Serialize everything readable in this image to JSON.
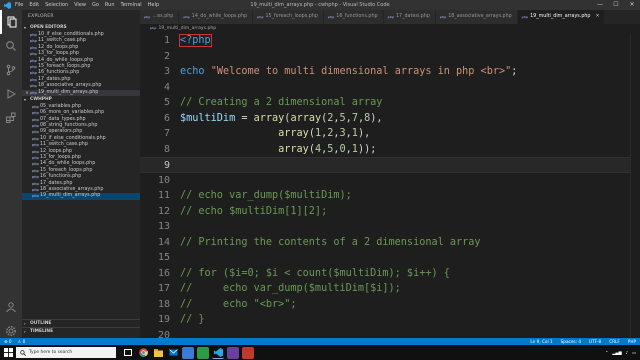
{
  "window": {
    "title": "19_multi_dim_arrays.php - cwhphp - Visual Studio Code",
    "menu": [
      "File",
      "Edit",
      "Selection",
      "View",
      "Go",
      "Run",
      "Terminal",
      "Help"
    ]
  },
  "sidebar": {
    "title": "EXPLORER",
    "open_editors_label": "OPEN EDITORS",
    "open_editors": [
      "10_if_else_conditionals.php",
      "11_switch_case.php",
      "12_do_loops.php",
      "13_for_loops.php",
      "14_do_while_loops.php",
      "15_foreach_loops.php",
      "16_functions.php",
      "17_dates.php",
      "18_associative_arrays.php",
      "19_multi_dim_arrays.php"
    ],
    "project_label": "CWHPHP",
    "files": [
      "05_variables.php",
      "06_more_on_variables.php",
      "07_data_types.php",
      "08_string_functions.php",
      "09_operators.php",
      "10_if_else_conditionals.php",
      "11_switch_case.php",
      "12_loops.php",
      "13_for_loops.php",
      "14_do_while_loops.php",
      "15_foreach_loops.php",
      "16_functions.php",
      "17_dates.php",
      "18_associative_arrays.php",
      "19_multi_dim_arrays.php"
    ],
    "outline_label": "OUTLINE",
    "timeline_label": "TIMELINE"
  },
  "tabs": [
    {
      "label": "…es.php",
      "active": false
    },
    {
      "label": "14_do_while_loops.php",
      "active": false
    },
    {
      "label": "15_foreach_loops.php",
      "active": false
    },
    {
      "label": "16_functions.php",
      "active": false
    },
    {
      "label": "17_datesi.php",
      "active": false
    },
    {
      "label": "18_associative_arrays.php",
      "active": false
    },
    {
      "label": "19_multi_dim_arrays.php",
      "active": true
    }
  ],
  "breadcrumb": "19_multi_dim_arrays.php",
  "editor": {
    "current_line": 9,
    "lines": [
      {
        "n": "1",
        "html": "<span class=\"k-tag phpopen\">&lt;?php</span>"
      },
      {
        "n": "2",
        "html": ""
      },
      {
        "n": "3",
        "html": "<span class=\"k-kw\">echo</span> <span class=\"k-str\">\"Welcome to multi dimensional arrays in php &lt;br&gt;\"</span><span class=\"k-op\">;</span>"
      },
      {
        "n": "4",
        "html": ""
      },
      {
        "n": "5",
        "html": "<span class=\"k-com\">// Creating a 2 dimensional array</span>"
      },
      {
        "n": "6",
        "html": "<span class=\"k-var\">$multiDim</span> <span class=\"k-op\">=</span> <span class=\"k-fn\">array</span><span class=\"k-op\">(</span><span class=\"k-fn\">array</span><span class=\"k-op\">(</span><span class=\"k-num\">2</span><span class=\"k-op\">,</span><span class=\"k-num\">5</span><span class=\"k-op\">,</span><span class=\"k-num\">7</span><span class=\"k-op\">,</span><span class=\"k-num\">8</span><span class=\"k-op\">),</span>"
      },
      {
        "n": "7",
        "html": "                <span class=\"k-fn\">array</span><span class=\"k-op\">(</span><span class=\"k-num\">1</span><span class=\"k-op\">,</span><span class=\"k-num\">2</span><span class=\"k-op\">,</span><span class=\"k-num\">3</span><span class=\"k-op\">,</span><span class=\"k-num\">1</span><span class=\"k-op\">),</span>"
      },
      {
        "n": "8",
        "html": "                <span class=\"k-fn\">array</span><span class=\"k-op\">(</span><span class=\"k-num\">4</span><span class=\"k-op\">,</span><span class=\"k-num\">5</span><span class=\"k-op\">,</span><span class=\"k-num\">0</span><span class=\"k-op\">,</span><span class=\"k-num\">1</span><span class=\"k-op\">));</span>"
      },
      {
        "n": "9",
        "html": ""
      },
      {
        "n": "10",
        "html": ""
      },
      {
        "n": "11",
        "html": "<span class=\"k-com\">// echo var_dump($multiDim);</span>"
      },
      {
        "n": "12",
        "html": "<span class=\"k-com\">// echo $multiDim[1][2];</span>"
      },
      {
        "n": "13",
        "html": ""
      },
      {
        "n": "14",
        "html": "<span class=\"k-com\">// Printing the contents of a 2 dimensional array</span>"
      },
      {
        "n": "15",
        "html": ""
      },
      {
        "n": "16",
        "html": "<span class=\"k-com\">// for ($i=0; $i &lt; count($multiDim); $i++) {</span>"
      },
      {
        "n": "17",
        "html": "<span class=\"k-com\">//     echo var_dump($multiDim[$i]);</span>"
      },
      {
        "n": "18",
        "html": "<span class=\"k-com\">//     echo \"&lt;br&gt;\";</span>"
      },
      {
        "n": "19",
        "html": "<span class=\"k-com\">// }</span>"
      },
      {
        "n": "20",
        "html": ""
      }
    ]
  },
  "statusbar": {
    "left": [
      "⊗ 0",
      "⚠ 0"
    ],
    "right": [
      "Ln 9, Col 1",
      "Spaces: 4",
      "UTF-8",
      "CRLF",
      "PHP"
    ]
  },
  "taskbar": {
    "search_placeholder": "Type here to search",
    "time": "",
    "date": ""
  }
}
